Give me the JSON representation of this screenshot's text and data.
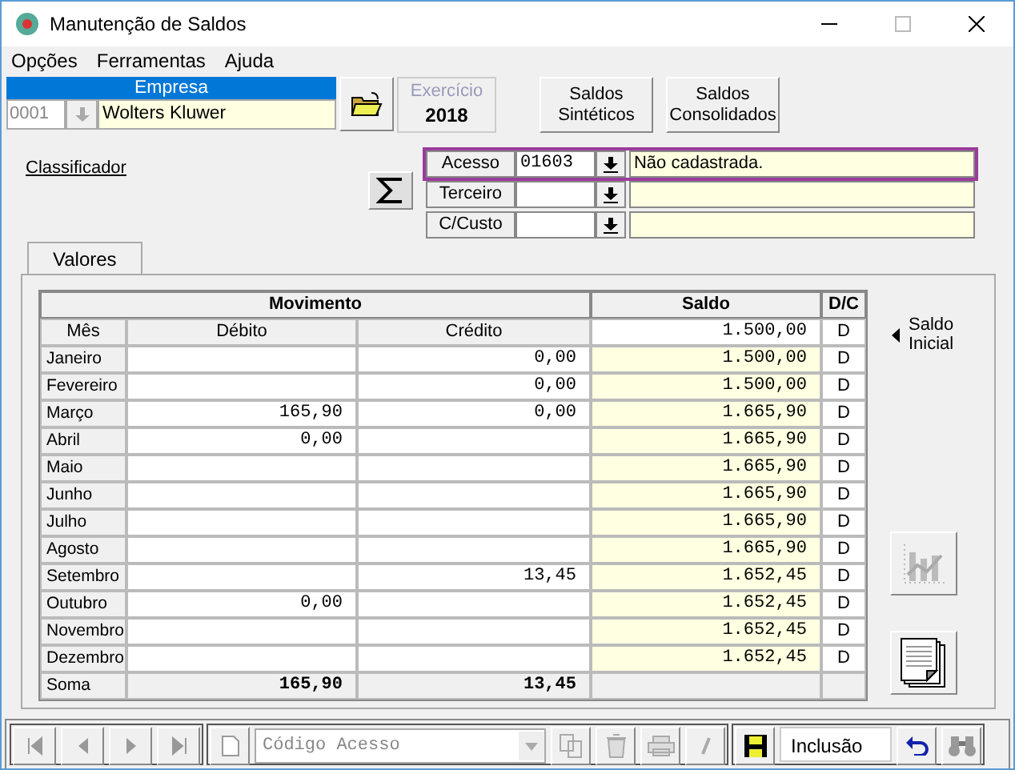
{
  "window": {
    "title": "Manutenção de Saldos"
  },
  "menu": [
    {
      "label": "Opções"
    },
    {
      "label": "Ferramentas"
    },
    {
      "label": "Ajuda"
    }
  ],
  "empresa": {
    "header": "Empresa",
    "code": "0001",
    "name": "Wolters Kluwer"
  },
  "exercicio": {
    "label": "Exercício",
    "value": "2018",
    "disabled": true
  },
  "buttons": [
    {
      "lines": [
        "Saldos",
        "Sintéticos"
      ]
    },
    {
      "lines": [
        "Saldos",
        "Consolidados"
      ]
    }
  ],
  "classificador": "Classificador",
  "filters": [
    {
      "label": "Acesso",
      "value": "01603",
      "description": "Não cadastrada.",
      "selected": true
    },
    {
      "label": "Terceiro",
      "selected": false
    },
    {
      "label": "C/Custo",
      "selected": false
    }
  ],
  "tabs": [
    {
      "label": "Valores",
      "selected": true
    }
  ],
  "table": {
    "group_headers": [
      "Movimento",
      "Saldo",
      "D/C"
    ],
    "columns": [
      "Mês",
      "Débito",
      "Crédito"
    ],
    "first_saldo": "1.500,00",
    "first_dc": "D",
    "rows": [
      {
        "month": "Janeiro",
        "credito": "0,00",
        "saldo": "1.500,00",
        "dc": "D"
      },
      {
        "month": "Fevereiro",
        "credito": "0,00",
        "saldo": "1.500,00",
        "dc": "D"
      },
      {
        "month": "Março",
        "debito": "165,90",
        "credito": "0,00",
        "saldo": "1.665,90",
        "dc": "D"
      },
      {
        "month": "Abril",
        "debito": "0,00",
        "saldo": "1.665,90",
        "dc": "D"
      },
      {
        "month": "Maio",
        "saldo": "1.665,90",
        "dc": "D"
      },
      {
        "month": "Junho",
        "saldo": "1.665,90",
        "dc": "D"
      },
      {
        "month": "Julho",
        "saldo": "1.665,90",
        "dc": "D"
      },
      {
        "month": "Agosto",
        "saldo": "1.665,90",
        "dc": "D"
      },
      {
        "month": "Setembro",
        "credito": "13,45",
        "saldo": "1.652,45",
        "dc": "D"
      },
      {
        "month": "Outubro",
        "debito": "0,00",
        "saldo": "1.652,45",
        "dc": "D"
      },
      {
        "month": "Novembro",
        "saldo": "1.652,45",
        "dc": "D"
      },
      {
        "month": "Dezembro",
        "saldo": "1.652,45",
        "dc": "D"
      }
    ],
    "total": {
      "label": "Soma",
      "debito": "165,90",
      "credito": "13,45"
    }
  },
  "saldo_inicial": "Saldo Inicial",
  "toolbar": {
    "search_placeholder": "Código Acesso",
    "mode": "Inclusão"
  }
}
